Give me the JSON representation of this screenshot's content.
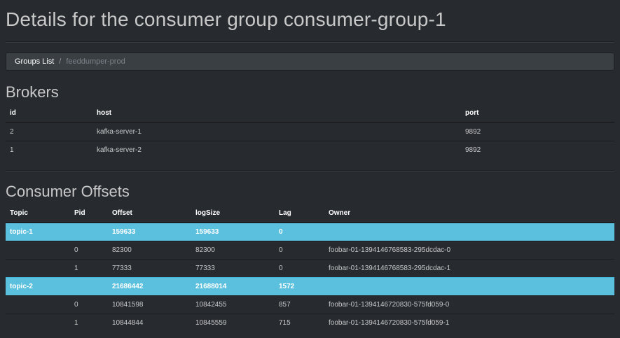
{
  "page": {
    "title": "Details for the consumer group consumer-group-1"
  },
  "breadcrumb": {
    "parent": "Groups List",
    "separator": "/",
    "current": "feeddumper-prod"
  },
  "brokers": {
    "title": "Brokers",
    "columns": [
      "id",
      "host",
      "port"
    ],
    "rows": [
      [
        "2",
        "kafka-server-1",
        "9892"
      ],
      [
        "1",
        "kafka-server-2",
        "9892"
      ]
    ]
  },
  "offsets": {
    "title": "Consumer Offsets",
    "columns": [
      "Topic",
      "Pid",
      "Offset",
      "logSize",
      "Lag",
      "Owner"
    ],
    "rows": [
      {
        "topic": "topic-1",
        "pid": "",
        "offset": "159633",
        "logsize": "159633",
        "lag": "0",
        "owner": "",
        "highlight": true
      },
      {
        "topic": "",
        "pid": "0",
        "offset": "82300",
        "logsize": "82300",
        "lag": "0",
        "owner": "foobar-01-1394146768583-295dcdac-0",
        "highlight": false
      },
      {
        "topic": "",
        "pid": "1",
        "offset": "77333",
        "logsize": "77333",
        "lag": "0",
        "owner": "foobar-01-1394146768583-295dcdac-1",
        "highlight": false
      },
      {
        "topic": "topic-2",
        "pid": "",
        "offset": "21686442",
        "logsize": "21688014",
        "lag": "1572",
        "owner": "",
        "highlight": true
      },
      {
        "topic": "",
        "pid": "0",
        "offset": "10841598",
        "logsize": "10842455",
        "lag": "857",
        "owner": "foobar-01-1394146720830-575fd059-0",
        "highlight": false
      },
      {
        "topic": "",
        "pid": "1",
        "offset": "10844844",
        "logsize": "10845559",
        "lag": "715",
        "owner": "foobar-01-1394146720830-575fd059-1",
        "highlight": false
      }
    ]
  },
  "colors": {
    "background": "#272b30",
    "highlight_row": "#5bc0de",
    "breadcrumb_bg": "#3a3f44"
  }
}
